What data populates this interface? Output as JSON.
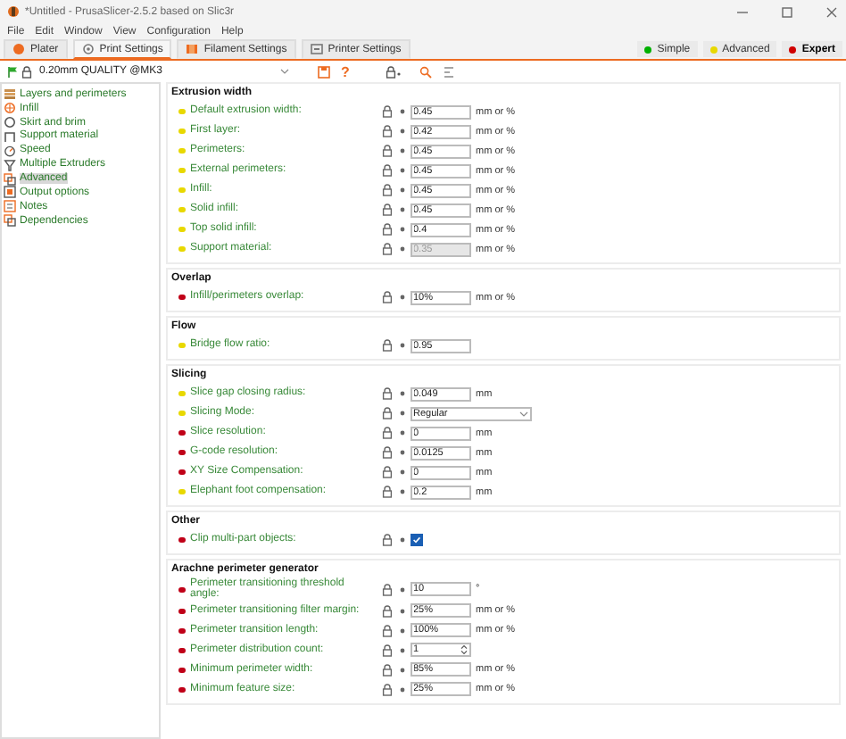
{
  "window": {
    "title": "*Untitled - PrusaSlicer-2.5.2 based on Slic3r"
  },
  "menu": [
    "File",
    "Edit",
    "Window",
    "View",
    "Configuration",
    "Help"
  ],
  "tabs": [
    {
      "label": "Plater",
      "selected": false
    },
    {
      "label": "Print Settings",
      "selected": true
    },
    {
      "label": "Filament Settings",
      "selected": false
    },
    {
      "label": "Printer Settings",
      "selected": false
    }
  ],
  "modes": [
    {
      "label": "Simple",
      "color": "#00b000",
      "selected": false
    },
    {
      "label": "Advanced",
      "color": "#e8d800",
      "selected": false
    },
    {
      "label": "Expert",
      "color": "#d00000",
      "selected": true
    }
  ],
  "preset": {
    "value": "0.20mm QUALITY @MK3",
    "help": "?"
  },
  "sidebar": {
    "items": [
      {
        "label": "Layers and perimeters",
        "selected": false
      },
      {
        "label": "Infill",
        "selected": false
      },
      {
        "label": "Skirt and brim",
        "selected": false
      },
      {
        "label": "Support material",
        "selected": false
      },
      {
        "label": "Speed",
        "selected": false
      },
      {
        "label": "Multiple Extruders",
        "selected": false
      },
      {
        "label": "Advanced",
        "selected": true
      },
      {
        "label": "Output options",
        "selected": false
      },
      {
        "label": "Notes",
        "selected": false
      },
      {
        "label": "Dependencies",
        "selected": false
      }
    ]
  },
  "groups": [
    {
      "title": "Extrusion width",
      "rows": [
        {
          "label": "Default extrusion width:",
          "color": "#e8d800",
          "kind": "text",
          "value": "0.45",
          "unit": "mm or %",
          "disabled": false
        },
        {
          "label": "First layer:",
          "color": "#e8d800",
          "kind": "text",
          "value": "0.42",
          "unit": "mm or %",
          "disabled": false
        },
        {
          "label": "Perimeters:",
          "color": "#e8d800",
          "kind": "text",
          "value": "0.45",
          "unit": "mm or %",
          "disabled": false
        },
        {
          "label": "External perimeters:",
          "color": "#e8d800",
          "kind": "text",
          "value": "0.45",
          "unit": "mm or %",
          "disabled": false
        },
        {
          "label": "Infill:",
          "color": "#e8d800",
          "kind": "text",
          "value": "0.45",
          "unit": "mm or %",
          "disabled": false
        },
        {
          "label": "Solid infill:",
          "color": "#e8d800",
          "kind": "text",
          "value": "0.45",
          "unit": "mm or %",
          "disabled": false
        },
        {
          "label": "Top solid infill:",
          "color": "#e8d800",
          "kind": "text",
          "value": "0.4",
          "unit": "mm or %",
          "disabled": false
        },
        {
          "label": "Support material:",
          "color": "#e8d800",
          "kind": "text",
          "value": "0.35",
          "unit": "mm or %",
          "disabled": true
        }
      ]
    },
    {
      "title": "Overlap",
      "rows": [
        {
          "label": "Infill/perimeters overlap:",
          "color": "#c00018",
          "kind": "text",
          "value": "10%",
          "unit": "mm or %",
          "disabled": false
        }
      ]
    },
    {
      "title": "Flow",
      "rows": [
        {
          "label": "Bridge flow ratio:",
          "color": "#e8d800",
          "kind": "text",
          "value": "0.95",
          "disabled": false
        }
      ]
    },
    {
      "title": "Slicing",
      "rows": [
        {
          "label": "Slice gap closing radius:",
          "color": "#e8d800",
          "kind": "text",
          "value": "0.049",
          "unit": "mm",
          "disabled": false
        },
        {
          "label": "Slicing Mode:",
          "color": "#e8d800",
          "kind": "select",
          "value": "Regular"
        },
        {
          "label": "Slice resolution:",
          "color": "#c00018",
          "kind": "text",
          "value": "0",
          "unit": "mm",
          "disabled": false
        },
        {
          "label": "G-code resolution:",
          "color": "#c00018",
          "kind": "text",
          "value": "0.0125",
          "unit": "mm",
          "disabled": false
        },
        {
          "label": "XY Size Compensation:",
          "color": "#c00018",
          "kind": "text",
          "value": "0",
          "unit": "mm",
          "disabled": false
        },
        {
          "label": "Elephant foot compensation:",
          "color": "#e8d800",
          "kind": "text",
          "value": "0.2",
          "unit": "mm",
          "disabled": false
        }
      ]
    },
    {
      "title": "Other",
      "rows": [
        {
          "label": "Clip multi-part objects:",
          "color": "#c00018",
          "kind": "checkbox",
          "checked": true
        }
      ]
    },
    {
      "title": "Arachne perimeter generator",
      "rows": [
        {
          "label": "Perimeter transitioning threshold angle:",
          "color": "#c00018",
          "kind": "text",
          "value": "10",
          "unit": "°",
          "disabled": false
        },
        {
          "label": "Perimeter transitioning filter margin:",
          "color": "#c00018",
          "kind": "text",
          "value": "25%",
          "unit": "mm or %",
          "disabled": false
        },
        {
          "label": "Perimeter transition length:",
          "color": "#c00018",
          "kind": "text",
          "value": "100%",
          "unit": "mm or %",
          "disabled": false
        },
        {
          "label": "Perimeter distribution count:",
          "color": "#c00018",
          "kind": "spin",
          "value": "1"
        },
        {
          "label": "Minimum perimeter width:",
          "color": "#c00018",
          "kind": "text",
          "value": "85%",
          "unit": "mm or %",
          "disabled": false
        },
        {
          "label": "Minimum feature size:",
          "color": "#c00018",
          "kind": "text",
          "value": "25%",
          "unit": "mm or %",
          "disabled": false
        }
      ]
    }
  ]
}
